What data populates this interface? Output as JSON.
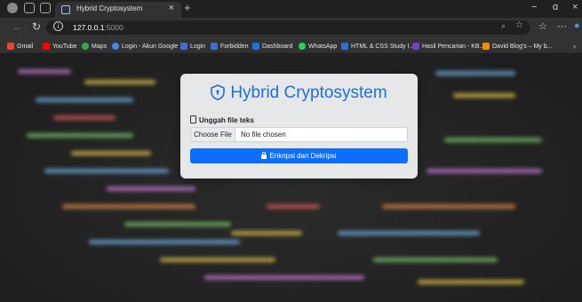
{
  "browser": {
    "tab_title": "Hybrid Cryptosystem",
    "tab_close": "×",
    "new_tab": "+",
    "url_host": "127.0.0.1",
    "url_port": ":5000",
    "window_controls": {
      "minimize": "−",
      "maximize": "ɑ",
      "close": "×"
    }
  },
  "bookmarks": [
    {
      "label": "Gmail",
      "icon": "gmail-icon",
      "color": "#ea4335"
    },
    {
      "label": "YouTube",
      "icon": "youtube-icon",
      "color": "#ff0000"
    },
    {
      "label": "Maps",
      "icon": "maps-icon",
      "color": "#34a853"
    },
    {
      "label": "Login - Akun Google",
      "icon": "google-icon",
      "color": "#4285f4"
    },
    {
      "label": "Login",
      "icon": "login-icon",
      "color": "#3b6fd8"
    },
    {
      "label": "Forbidden",
      "icon": "forbidden-icon",
      "color": "#3b6fd8"
    },
    {
      "label": "Dashboard",
      "icon": "dashboard-icon",
      "color": "#1a73e8"
    },
    {
      "label": "WhatsApp",
      "icon": "whatsapp-icon",
      "color": "#25d366"
    },
    {
      "label": "HTML & CSS Study I...",
      "icon": "study-icon",
      "color": "#2f6fdb"
    },
    {
      "label": "Hasil Pencarian - KB...",
      "icon": "k-icon",
      "color": "#6f42c1"
    },
    {
      "label": "David Blog's – My b...",
      "icon": "blog-icon",
      "color": "#f08c00"
    }
  ],
  "card": {
    "title": "Hybrid Cryptosystem",
    "upload_label": "Unggah file teks",
    "file_button": "Choose File",
    "file_value": "No file chosen",
    "submit_label": "Enkripsi dan Dekripsi"
  },
  "colors": {
    "accent": "#0d6efd",
    "title": "#1e6fd9"
  }
}
